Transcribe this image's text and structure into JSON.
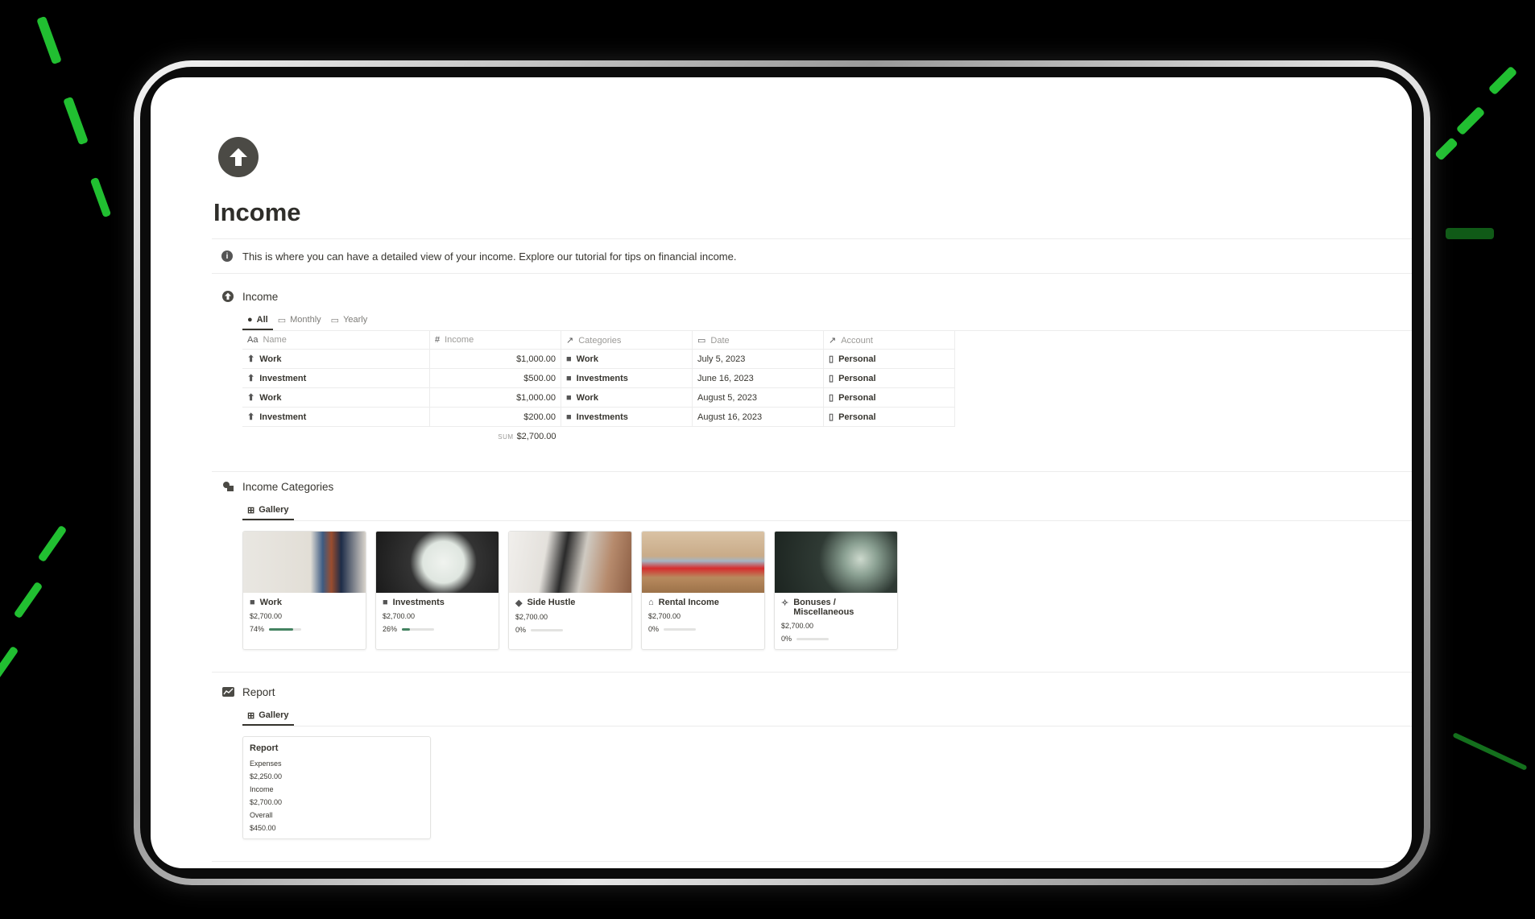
{
  "page": {
    "title": "Income",
    "callout": "This is where you can have a detailed view of your income. Explore our tutorial for tips on financial income."
  },
  "income_db": {
    "title": "Income",
    "views": [
      "All",
      "Monthly",
      "Yearly"
    ],
    "columns": [
      "Name",
      "Income",
      "Categories",
      "Date",
      "Account"
    ],
    "rows": [
      {
        "name": "Work",
        "income": "$1,000.00",
        "category": "Work",
        "date": "July 5, 2023",
        "account": "Personal"
      },
      {
        "name": "Investment",
        "income": "$500.00",
        "category": "Investments",
        "date": "June 16, 2023",
        "account": "Personal"
      },
      {
        "name": "Work",
        "income": "$1,000.00",
        "category": "Work",
        "date": "August 5, 2023",
        "account": "Personal"
      },
      {
        "name": "Investment",
        "income": "$200.00",
        "category": "Investments",
        "date": "August 16, 2023",
        "account": "Personal"
      }
    ],
    "sum_label": "SUM",
    "sum_value": "$2,700.00"
  },
  "categories_db": {
    "title": "Income Categories",
    "view": "Gallery",
    "cards": [
      {
        "title": "Work",
        "amount": "$2,700.00",
        "percent_label": "74%",
        "progress": 0.74,
        "icon": "briefcase-icon"
      },
      {
        "title": "Investments",
        "amount": "$2,700.00",
        "percent_label": "26%",
        "progress": 0.26,
        "icon": "chart-icon"
      },
      {
        "title": "Side Hustle",
        "amount": "$2,700.00",
        "percent_label": "0%",
        "progress": 0,
        "icon": "rocket-icon"
      },
      {
        "title": "Rental Income",
        "amount": "$2,700.00",
        "percent_label": "0%",
        "progress": 0,
        "icon": "house-icon"
      },
      {
        "title": "Bonuses / Miscellaneous",
        "amount": "$2,700.00",
        "percent_label": "0%",
        "progress": 0,
        "icon": "magic-wand-icon"
      }
    ]
  },
  "report_db": {
    "title": "Report",
    "view": "Gallery",
    "card": {
      "title": "Report",
      "expenses_label": "Expenses",
      "expenses_value": "$2,250.00",
      "income_label": "Income",
      "income_value": "$2,700.00",
      "overall_label": "Overall",
      "overall_value": "$450.00"
    }
  },
  "colors": {
    "accent_green": "#448361",
    "background": "#000000",
    "streak_green": "#27e03a"
  }
}
